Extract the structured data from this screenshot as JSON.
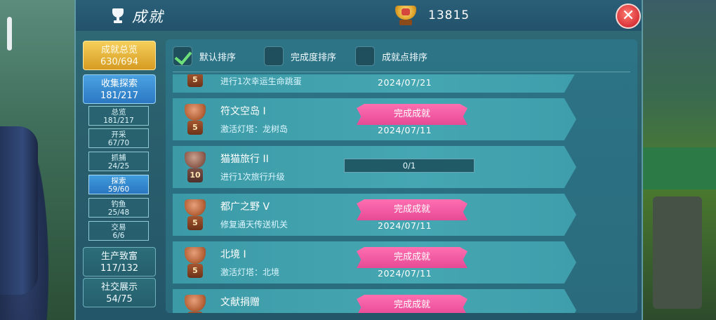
{
  "header": {
    "title": "成就",
    "points": "13815",
    "close_label": "✕"
  },
  "sidebar": {
    "total": {
      "label": "成就总览",
      "count": "630/694"
    },
    "collect": {
      "label": "收集探索",
      "count": "181/217"
    },
    "subs": [
      {
        "label": "总览",
        "count": "181/217"
      },
      {
        "label": "开采",
        "count": "67/70"
      },
      {
        "label": "抓捕",
        "count": "24/25"
      },
      {
        "label": "探索",
        "count": "59/60"
      },
      {
        "label": "钓鱼",
        "count": "25/48"
      },
      {
        "label": "交易",
        "count": "6/6"
      }
    ],
    "produce": {
      "label": "生产致富",
      "count": "117/132"
    },
    "social": {
      "label": "社交展示",
      "count": "54/75"
    }
  },
  "sort": {
    "default": "默认排序",
    "completion": "完成度排序",
    "points": "成就点排序"
  },
  "rows": [
    {
      "name": "",
      "desc": "进行1次幸运生命跳蛋",
      "level": "5",
      "ribbon": "",
      "date": "2024/07/21"
    },
    {
      "name": "符文空岛 I",
      "desc": "激活灯塔：龙树岛",
      "level": "5",
      "ribbon": "完成成就",
      "date": "2024/07/11"
    },
    {
      "name": "猫猫旅行 II",
      "desc": "进行1次旅行升级",
      "level": "10",
      "progress": "0/1"
    },
    {
      "name": "都广之野 V",
      "desc": "修复通天传送机关",
      "level": "5",
      "ribbon": "完成成就",
      "date": "2024/07/11"
    },
    {
      "name": "北境 I",
      "desc": "激活灯塔：北境",
      "level": "5",
      "ribbon": "完成成就",
      "date": "2024/07/11"
    },
    {
      "name": "文献捐赠",
      "desc": "",
      "level": "",
      "ribbon": "完成成就",
      "date": ""
    }
  ],
  "colors": {
    "panel": "#2a5f6c",
    "row": "#45a7b2",
    "ribbon": "#e64a96",
    "gold_button": "#d69b22",
    "blue_button": "#2b78c2",
    "close": "#d8333a"
  }
}
